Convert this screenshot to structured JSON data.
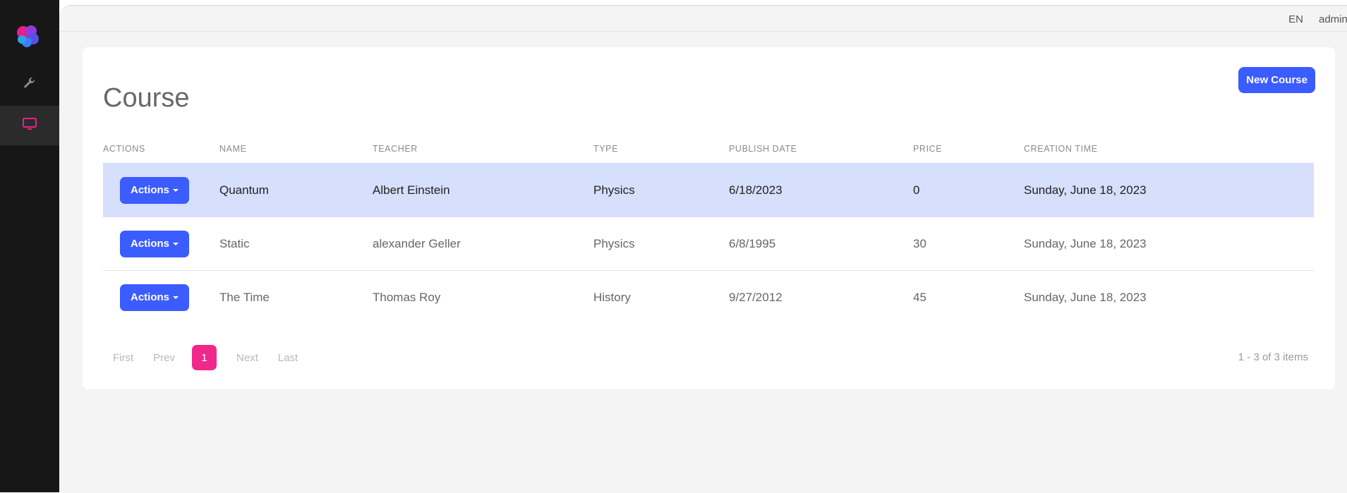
{
  "header": {
    "language": "EN",
    "user": "admin"
  },
  "page": {
    "title": "Course",
    "new_button": "New Course"
  },
  "table": {
    "columns": [
      "ACTIONS",
      "NAME",
      "TEACHER",
      "TYPE",
      "PUBLISH DATE",
      "PRICE",
      "CREATION TIME"
    ],
    "action_label": "Actions",
    "rows": [
      {
        "name": "Quantum",
        "teacher": "Albert Einstein",
        "type": "Physics",
        "publish_date": "6/18/2023",
        "price": "0",
        "creation_time": "Sunday, June 18, 2023"
      },
      {
        "name": "Static",
        "teacher": "alexander Geller",
        "type": "Physics",
        "publish_date": "6/8/1995",
        "price": "30",
        "creation_time": "Sunday, June 18, 2023"
      },
      {
        "name": "The Time",
        "teacher": "Thomas Roy",
        "type": "History",
        "publish_date": "9/27/2012",
        "price": "45",
        "creation_time": "Sunday, June 18, 2023"
      }
    ]
  },
  "pagination": {
    "first": "First",
    "prev": "Prev",
    "current": "1",
    "next": "Next",
    "last": "Last",
    "summary": "1 - 3 of 3 items"
  },
  "colors": {
    "accent": "#3b5cff",
    "pink": "#f0288a",
    "sidebar": "#171717",
    "selected_row": "#d6dffb"
  },
  "icons": {
    "logo": "app-logo",
    "sidebar": [
      "wrench-icon",
      "monitor-icon"
    ]
  }
}
